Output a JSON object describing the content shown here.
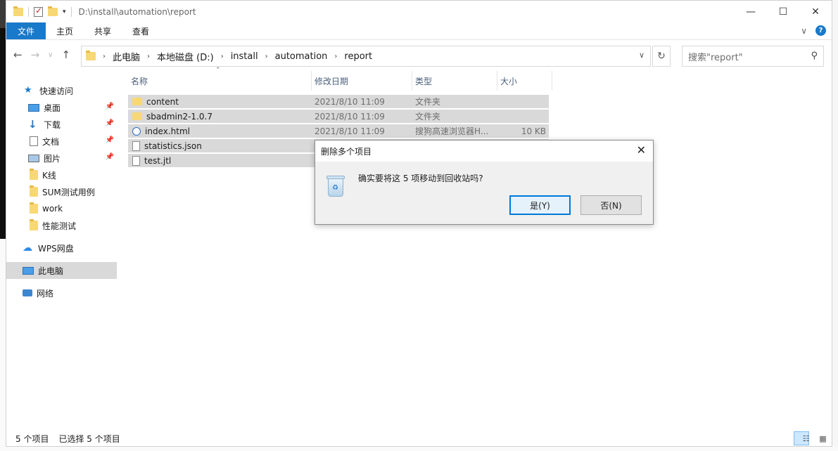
{
  "window": {
    "title_path": "D:\\install\\automation\\report",
    "controls": {
      "minimize": "—",
      "maximize": "☐",
      "close": "✕"
    }
  },
  "ribbon": {
    "tabs": [
      "文件",
      "主页",
      "共享",
      "查看"
    ],
    "collapse_glyph": "∨",
    "help_glyph": "?"
  },
  "nav": {
    "back": "←",
    "forward": "→",
    "recent": "∨",
    "up": "↑",
    "breadcrumbs": [
      "此电脑",
      "本地磁盘 (D:)",
      "install",
      "automation",
      "report"
    ],
    "search_placeholder": "搜索\"report\""
  },
  "sidebar": {
    "items": [
      {
        "label": "快速访问",
        "icon": "star-icon"
      },
      {
        "label": "桌面",
        "icon": "desktop-icon",
        "pinned": true
      },
      {
        "label": "下载",
        "icon": "download-icon",
        "pinned": true
      },
      {
        "label": "文档",
        "icon": "document-icon",
        "pinned": true
      },
      {
        "label": "图片",
        "icon": "picture-icon",
        "pinned": true
      },
      {
        "label": "K线",
        "icon": "folder-icon"
      },
      {
        "label": "SUM测试用例",
        "icon": "folder-icon"
      },
      {
        "label": "work",
        "icon": "folder-icon"
      },
      {
        "label": "性能测试",
        "icon": "folder-icon"
      },
      {
        "label": "WPS网盘",
        "icon": "cloud-icon"
      },
      {
        "label": "此电脑",
        "icon": "computer-icon",
        "selected": true
      },
      {
        "label": "网络",
        "icon": "network-icon"
      }
    ]
  },
  "columns": [
    "名称",
    "修改日期",
    "类型",
    "大小"
  ],
  "files": [
    {
      "name": "content",
      "date": "2021/8/10 11:09",
      "type": "文件夹",
      "size": "",
      "kind": "folder"
    },
    {
      "name": "sbadmin2-1.0.7",
      "date": "2021/8/10 11:09",
      "type": "文件夹",
      "size": "",
      "kind": "folder"
    },
    {
      "name": "index.html",
      "date": "2021/8/10 11:09",
      "type": "搜狗高速浏览器H...",
      "size": "10 KB",
      "kind": "html"
    },
    {
      "name": "statistics.json",
      "date": "",
      "type": "",
      "size": "",
      "kind": "file"
    },
    {
      "name": "test.jtl",
      "date": "",
      "type": "",
      "size": "",
      "kind": "file"
    }
  ],
  "status": {
    "count": "5 个项目",
    "selected": "已选择 5 个项目"
  },
  "dialog": {
    "title": "删除多个项目",
    "message": "确实要将这 5 项移动到回收站吗?",
    "yes": "是(Y)",
    "no": "否(N)",
    "close": "✕"
  }
}
